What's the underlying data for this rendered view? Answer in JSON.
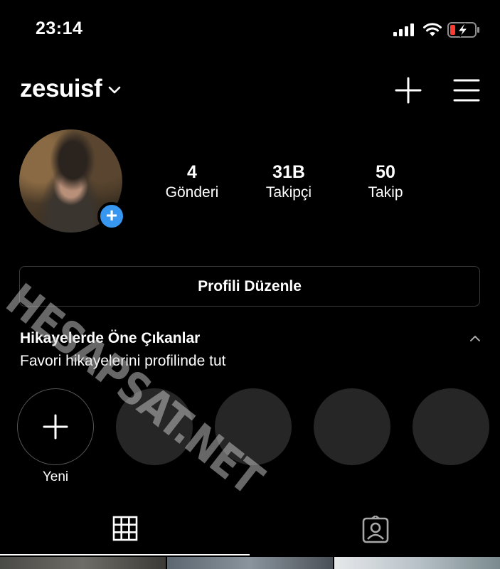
{
  "status_bar": {
    "time": "23:14",
    "battery_color": "#ff3b30"
  },
  "header": {
    "username": "zesuisf",
    "icons": [
      "chevron-down-icon",
      "plus-icon",
      "menu-icon"
    ]
  },
  "profile": {
    "stats": [
      {
        "value": "4",
        "label": "Gönderi"
      },
      {
        "value": "31B",
        "label": "Takipçi"
      },
      {
        "value": "50",
        "label": "Takip"
      }
    ],
    "edit_button": "Profili Düzenle",
    "add_story_color": "#3797f0"
  },
  "watermark": "HESAPSAT.NET",
  "highlights": {
    "title": "Hikayelerde Öne Çıkanlar",
    "subtitle": "Favori hikayelerini profilinde tut",
    "new_label": "Yeni",
    "placeholder_count": 4
  },
  "tabs": [
    {
      "icon": "grid-icon",
      "active": true
    },
    {
      "icon": "tagged-icon",
      "active": false
    }
  ]
}
